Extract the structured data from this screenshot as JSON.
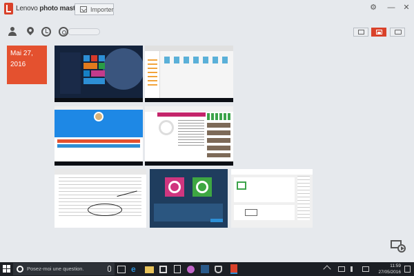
{
  "app": {
    "brand_prefix": "Lenovo",
    "brand_name": " photo master",
    "import_label": "Importer"
  },
  "window_controls": [
    "⚙",
    "—",
    "✕"
  ],
  "toolbar": {
    "icons": [
      "person-icon",
      "location-pin-icon",
      "clock-icon",
      "search-icon"
    ],
    "search_placeholder": ""
  },
  "view_modes": [
    "calendar-view",
    "photo-view",
    "folder-view"
  ],
  "gallery": {
    "date_group": "Mai 27, 2016",
    "thumbnails": [
      "Windows 10 start menu screenshot",
      "Explorer window screenshot",
      "Browser login page screenshot",
      "Web page article screenshot",
      "Document with handwritten signature",
      "OneKey Recovery dialog",
      "McAfee security window"
    ]
  },
  "taskbar": {
    "search_placeholder": "Posez-moi une question.",
    "time": "11:59",
    "date": "27/05/2016"
  },
  "colors": {
    "accent": "#e4512f",
    "background": "#e6e9ed",
    "taskbar": "#1c1f24"
  }
}
